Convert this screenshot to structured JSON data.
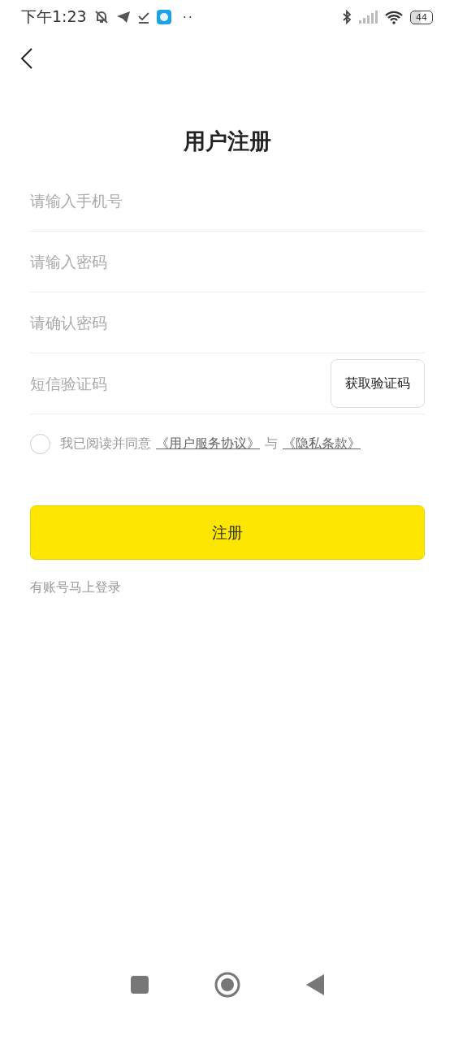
{
  "status_bar": {
    "time": "下午1:23",
    "more": "··",
    "battery": "44"
  },
  "title": "用户注册",
  "fields": [
    {
      "placeholder": "请输入手机号"
    },
    {
      "placeholder": "请输入密码"
    },
    {
      "placeholder": "请确认密码"
    },
    {
      "placeholder": "短信验证码",
      "button": "获取验证码"
    }
  ],
  "agreement": {
    "checked": false,
    "text": "我已阅读并同意",
    "link_1": "《用户服务协议》",
    "joiner": "与",
    "link_2": "《隐私条款》"
  },
  "submit": "注册",
  "login_link": "有账号马上登录"
}
